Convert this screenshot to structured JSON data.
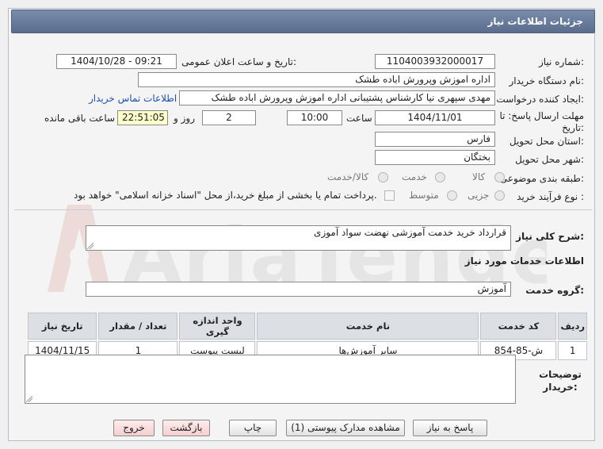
{
  "header": {
    "title": "جزئیات اطلاعات نیاز"
  },
  "labels": {
    "need_number": "شماره نیاز:",
    "announce_datetime": "تاریخ و ساعت اعلان عمومی:",
    "buyer_org": "نام دستگاه خریدار:",
    "requester": "ایجاد کننده درخواست:",
    "deadline": "مهلت ارسال پاسخ: تا تاریخ:",
    "hour": "ساعت",
    "day_and": "روز و",
    "remaining": "ساعت باقی مانده",
    "province": "استان محل تحویل:",
    "city": "شهر محل تحویل:",
    "category": "طبقه بندی موضوعی:",
    "process_type": "نوع فرآیند خرید :",
    "general_desc": "شرح کلی نیاز:",
    "services_info": "اطلاعات خدمات مورد نیاز",
    "service_group": "گروه خدمت:",
    "buyer_notes": "توضیحات خریدار:"
  },
  "values": {
    "need_number": "1104003932000017",
    "announce_datetime": "1404/10/28 - 09:21",
    "buyer_org": "اداره اموزش وپرورش اباده طشک",
    "requester": "مهدی سپهری نیا کارشناس پشتیبانی اداره اموزش وپرورش اباده طشک",
    "contact_link": "اطلاعات تماس خریدار",
    "deadline_date": "1404/11/01",
    "deadline_time": "10:00",
    "days": "2",
    "remaining_time": "22:51:05",
    "province": "فارس",
    "city": "بختگان",
    "general_desc": "قرارداد خرید خدمت آموزشی نهضت سواد آموزی",
    "service_group": "آموزش",
    "buyer_notes": ""
  },
  "category_options": [
    "کالا",
    "خدمت",
    "کالا/خدمت"
  ],
  "process_options": [
    "جزیی",
    "متوسط"
  ],
  "payment_note": "پرداخت تمام یا بخشی از مبلغ خرید،از محل \"اسناد خزانه اسلامی\" خواهد بود.",
  "table": {
    "headers": [
      "ردیف",
      "کد خدمت",
      "نام خدمت",
      "واحد اندازه گیری",
      "تعداد / مقدار",
      "تاریخ نیاز"
    ],
    "rows": [
      [
        "1",
        "ش-85-854",
        "سایر آموزش‌ها",
        "لیست پیوست",
        "1",
        "1404/11/15"
      ]
    ]
  },
  "buttons": {
    "reply": "پاسخ به نیاز",
    "attachments": "مشاهده مدارک پیوستی (1)",
    "print": "چاپ",
    "back": "بازگشت",
    "exit": "خروج"
  },
  "watermark": {
    "brand": "AriaTender.net"
  },
  "colors": {
    "title_bar": "#6a7d9d",
    "link": "#1c4fb8",
    "yellow_field": "#ffffcc",
    "watermark": "#c0392b"
  }
}
